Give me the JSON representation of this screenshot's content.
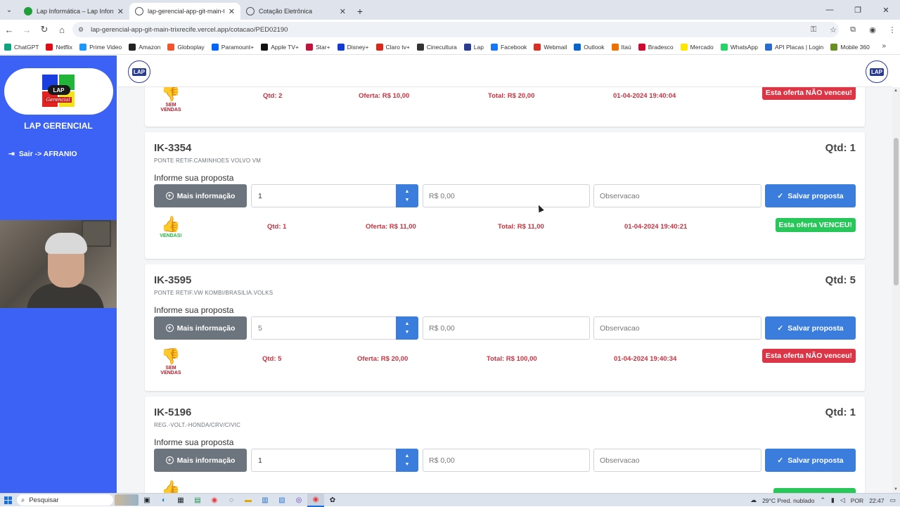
{
  "browser": {
    "tabs": [
      {
        "title": "Lap Informática – Lap Informát",
        "favicon_color": "#1f9e3a",
        "active": false
      },
      {
        "title": "lap-gerencial-app-git-main-trix",
        "favicon_color": "#555555",
        "active": true
      },
      {
        "title": "Cotação Eletrônica",
        "favicon_color": "#555555",
        "active": false
      }
    ],
    "url": "lap-gerencial-app-git-main-trixrecife.vercel.app/cotacao/PED02190",
    "bookmarks": [
      {
        "label": "ChatGPT",
        "color": "#10a37f"
      },
      {
        "label": "Netflix",
        "color": "#e50914"
      },
      {
        "label": "Prime Video",
        "color": "#1a98ff"
      },
      {
        "label": "Amazon",
        "color": "#222222"
      },
      {
        "label": "Globoplay",
        "color": "#f2542d"
      },
      {
        "label": "Paramount+",
        "color": "#0064ff"
      },
      {
        "label": "Apple TV+",
        "color": "#111111"
      },
      {
        "label": "Star+",
        "color": "#c4123e"
      },
      {
        "label": "Disney+",
        "color": "#113ccf"
      },
      {
        "label": "Claro tv+",
        "color": "#da291c"
      },
      {
        "label": "Cinecultura",
        "color": "#333333"
      },
      {
        "label": "Lap",
        "color": "#2a3c92"
      },
      {
        "label": "Facebook",
        "color": "#1877f2"
      },
      {
        "label": "Webmail",
        "color": "#d93025"
      },
      {
        "label": "Outlook",
        "color": "#0a64c9"
      },
      {
        "label": "Itaú",
        "color": "#ec7000"
      },
      {
        "label": "Bradesco",
        "color": "#cc092f"
      },
      {
        "label": "Mercado",
        "color": "#ffe600"
      },
      {
        "label": "WhatsApp",
        "color": "#25d366"
      },
      {
        "label": "API Placas | Login",
        "color": "#2a6bd1"
      },
      {
        "label": "Mobile 360",
        "color": "#6b8e23"
      }
    ]
  },
  "sidebar": {
    "brand": "LAP GERENCIAL",
    "logo_text": "LAP",
    "logo_sub": "Gerencial",
    "logout": "Sair -> AFRANIO"
  },
  "navbar": {
    "logo_text": "LAP"
  },
  "labels": {
    "prompt": "Informe sua proposta",
    "more_info": "Mais informação",
    "save": "Salvar proposta",
    "obs_placeholder": "Observacao",
    "price_placeholder": "R$ 0,00",
    "won_badge": "Esta oferta VENCEU!",
    "lost_badge": "Esta oferta NÃO venceu!",
    "won_label": "VENDAS!",
    "lost_label": "SEM VENDAS"
  },
  "top_result": {
    "qtd": "Qtd: 2",
    "oferta": "Oferta: R$ 10,00",
    "total": "Total: R$ 20,00",
    "date": "01-04-2024 19:40:04"
  },
  "items": [
    {
      "code": "IK-3354",
      "desc": "PONTE RETIF.CAMINHOES VOLVO VM",
      "qty_label": "Qtd: 1",
      "qty_value": "1",
      "result": {
        "qtd": "Qtd: 1",
        "oferta": "Oferta: R$ 11,00",
        "total": "Total: R$ 11,00",
        "date": "01-04-2024 19:40:21"
      }
    },
    {
      "code": "IK-3595",
      "desc": "PONTE RETIF.VW KOMBI/BRASILIA.VOLKS",
      "qty_label": "Qtd: 5",
      "qty_value": "5",
      "result": {
        "qtd": "Qtd: 5",
        "oferta": "Oferta: R$ 20,00",
        "total": "Total: R$ 100,00",
        "date": "01-04-2024 19:40:34"
      }
    },
    {
      "code": "IK-5196",
      "desc": "REG.-VOLT.-HONDA/CRV/CIVIC",
      "qty_label": "Qtd: 1",
      "qty_value": "1"
    }
  ],
  "taskbar": {
    "search": "Pesquisar",
    "weather": "29°C  Pred. nublado",
    "lang": "POR",
    "time": "22:47"
  }
}
